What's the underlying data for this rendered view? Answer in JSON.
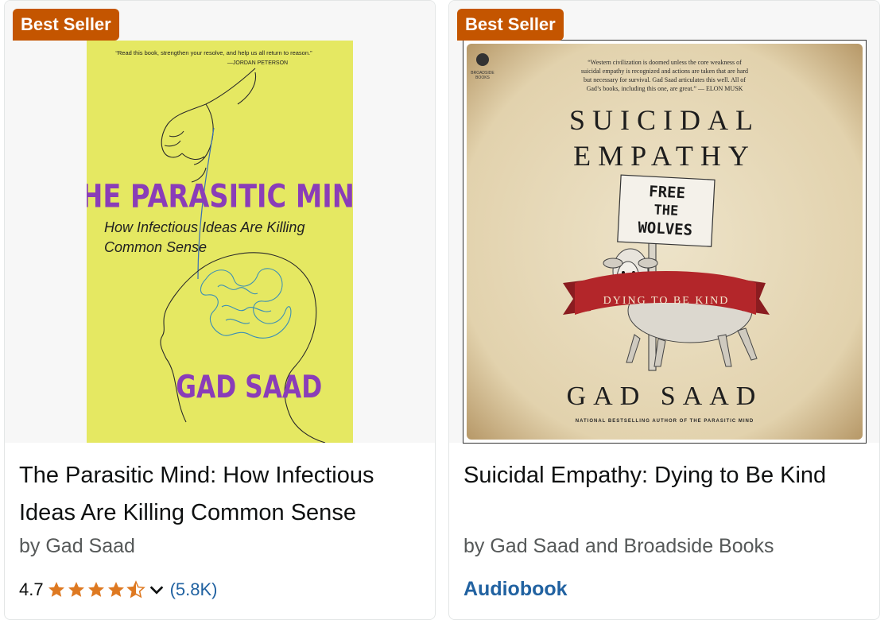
{
  "products": [
    {
      "badge": "Best Seller",
      "title": "The Parasitic Mind: How Infectious Ideas Are Killing Common Sense",
      "byline": "by Gad Saad",
      "rating": "4.7",
      "rating_value": 4.7,
      "review_count": "(5.8K)",
      "cover": {
        "quote": "“Read this book, strengthen your resolve, and help us all return to reason.”",
        "quote_attr": "—JORDAN PETERSON",
        "title": "THE PARASITIC MIND",
        "subtitle_line1": "How Infectious Ideas Are Killing",
        "subtitle_line2": "Common Sense",
        "author": "GAD SAAD"
      }
    },
    {
      "badge": "Best Seller",
      "title": "Suicidal Empathy: Dying to Be Kind",
      "byline": "by Gad Saad and Broadside Books",
      "format": "Audiobook",
      "cover": {
        "publisher_line1": "BROADSIDE",
        "publisher_line2": "BOOKS",
        "quote_line1": "“Western civilization is doomed unless the core weakness of",
        "quote_line2": "suicidal empathy is recognized and actions are taken that are hard",
        "quote_line3": "but necessary for survival. Gad Saad articulates this well. All of",
        "quote_line4": "Gad’s books, including this one, are great.” — ELON MUSK",
        "title_line1": "SUICIDAL",
        "title_line2": "EMPATHY",
        "sign_line1": "FREE",
        "sign_line2": "THE",
        "sign_line3": "WOLVES",
        "banner": "DYING TO BE KIND",
        "author": "GAD SAAD",
        "tagline": "NATIONAL BESTSELLING AUTHOR OF THE PARASITIC MIND"
      }
    }
  ],
  "colors": {
    "badge": "#c45500",
    "star": "#de7921",
    "link": "#2162a1",
    "cover1_bg": "#e5e862",
    "cover2_bg": "#e9dcc0",
    "banner": "#b3262a"
  },
  "icons": [
    "star-icon",
    "chevron-down-icon",
    "sheep-illustration",
    "head-line-art"
  ]
}
